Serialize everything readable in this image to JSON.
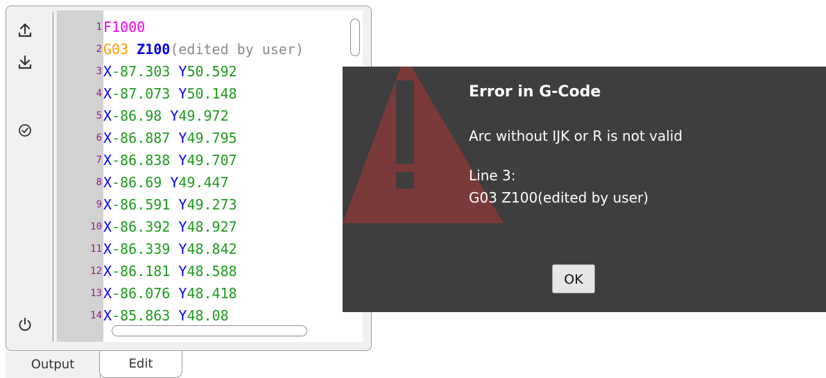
{
  "toolbar": {
    "icons": [
      "upload-icon",
      "download-icon",
      "check-circle-icon",
      "power-icon"
    ]
  },
  "editor": {
    "lines": [
      {
        "num": "1",
        "tokens": [
          {
            "t": "F1000",
            "c": "tk-f"
          }
        ]
      },
      {
        "num": "2",
        "tokens": [
          {
            "t": "G03",
            "c": "tk-g"
          },
          {
            "t": " ",
            "c": ""
          },
          {
            "t": "Z100",
            "c": "tk-z"
          },
          {
            "t": "(edited by user)",
            "c": "tk-cm"
          }
        ]
      },
      {
        "num": "3",
        "tokens": [
          {
            "t": "X",
            "c": "tk-x"
          },
          {
            "t": "-87.303",
            "c": "tk-n"
          },
          {
            "t": " Y",
            "c": "tk-y"
          },
          {
            "t": "50.592",
            "c": "tk-n"
          }
        ]
      },
      {
        "num": "4",
        "tokens": [
          {
            "t": "X",
            "c": "tk-x"
          },
          {
            "t": "-87.073",
            "c": "tk-n"
          },
          {
            "t": " Y",
            "c": "tk-y"
          },
          {
            "t": "50.148",
            "c": "tk-n"
          }
        ]
      },
      {
        "num": "5",
        "tokens": [
          {
            "t": "X",
            "c": "tk-x"
          },
          {
            "t": "-86.98",
            "c": "tk-n"
          },
          {
            "t": " Y",
            "c": "tk-y"
          },
          {
            "t": "49.972",
            "c": "tk-n"
          }
        ]
      },
      {
        "num": "6",
        "tokens": [
          {
            "t": "X",
            "c": "tk-x"
          },
          {
            "t": "-86.887",
            "c": "tk-n"
          },
          {
            "t": " Y",
            "c": "tk-y"
          },
          {
            "t": "49.795",
            "c": "tk-n"
          }
        ]
      },
      {
        "num": "7",
        "tokens": [
          {
            "t": "X",
            "c": "tk-x"
          },
          {
            "t": "-86.838",
            "c": "tk-n"
          },
          {
            "t": " Y",
            "c": "tk-y"
          },
          {
            "t": "49.707",
            "c": "tk-n"
          }
        ]
      },
      {
        "num": "8",
        "tokens": [
          {
            "t": "X",
            "c": "tk-x"
          },
          {
            "t": "-86.69",
            "c": "tk-n"
          },
          {
            "t": " Y",
            "c": "tk-y"
          },
          {
            "t": "49.447",
            "c": "tk-n"
          }
        ]
      },
      {
        "num": "9",
        "tokens": [
          {
            "t": "X",
            "c": "tk-x"
          },
          {
            "t": "-86.591",
            "c": "tk-n"
          },
          {
            "t": " Y",
            "c": "tk-y"
          },
          {
            "t": "49.273",
            "c": "tk-n"
          }
        ]
      },
      {
        "num": "10",
        "tokens": [
          {
            "t": "X",
            "c": "tk-x"
          },
          {
            "t": "-86.392",
            "c": "tk-n"
          },
          {
            "t": " Y",
            "c": "tk-y"
          },
          {
            "t": "48.927",
            "c": "tk-n"
          }
        ]
      },
      {
        "num": "11",
        "tokens": [
          {
            "t": "X",
            "c": "tk-x"
          },
          {
            "t": "-86.339",
            "c": "tk-n"
          },
          {
            "t": " Y",
            "c": "tk-y"
          },
          {
            "t": "48.842",
            "c": "tk-n"
          }
        ]
      },
      {
        "num": "12",
        "tokens": [
          {
            "t": "X",
            "c": "tk-x"
          },
          {
            "t": "-86.181",
            "c": "tk-n"
          },
          {
            "t": " Y",
            "c": "tk-y"
          },
          {
            "t": "48.588",
            "c": "tk-n"
          }
        ]
      },
      {
        "num": "13",
        "tokens": [
          {
            "t": "X",
            "c": "tk-x"
          },
          {
            "t": "-86.076",
            "c": "tk-n"
          },
          {
            "t": " Y",
            "c": "tk-y"
          },
          {
            "t": "48.418",
            "c": "tk-n"
          }
        ]
      },
      {
        "num": "14",
        "tokens": [
          {
            "t": "X",
            "c": "tk-x"
          },
          {
            "t": "-85.863",
            "c": "tk-n"
          },
          {
            "t": " Y",
            "c": "tk-y"
          },
          {
            "t": "48.08",
            "c": "tk-n"
          }
        ]
      }
    ]
  },
  "tabs": {
    "output": "Output",
    "edit": "Edit"
  },
  "dialog": {
    "title": "Error in G-Code",
    "message": "Arc without IJK or R is not valid",
    "line_label": "Line 3:",
    "line_code": "G03 Z100(edited by user)",
    "ok_label": "OK",
    "icon": "warning-triangle-icon",
    "background": "#3e3e3e",
    "icon_color": "#7a3a3a"
  }
}
